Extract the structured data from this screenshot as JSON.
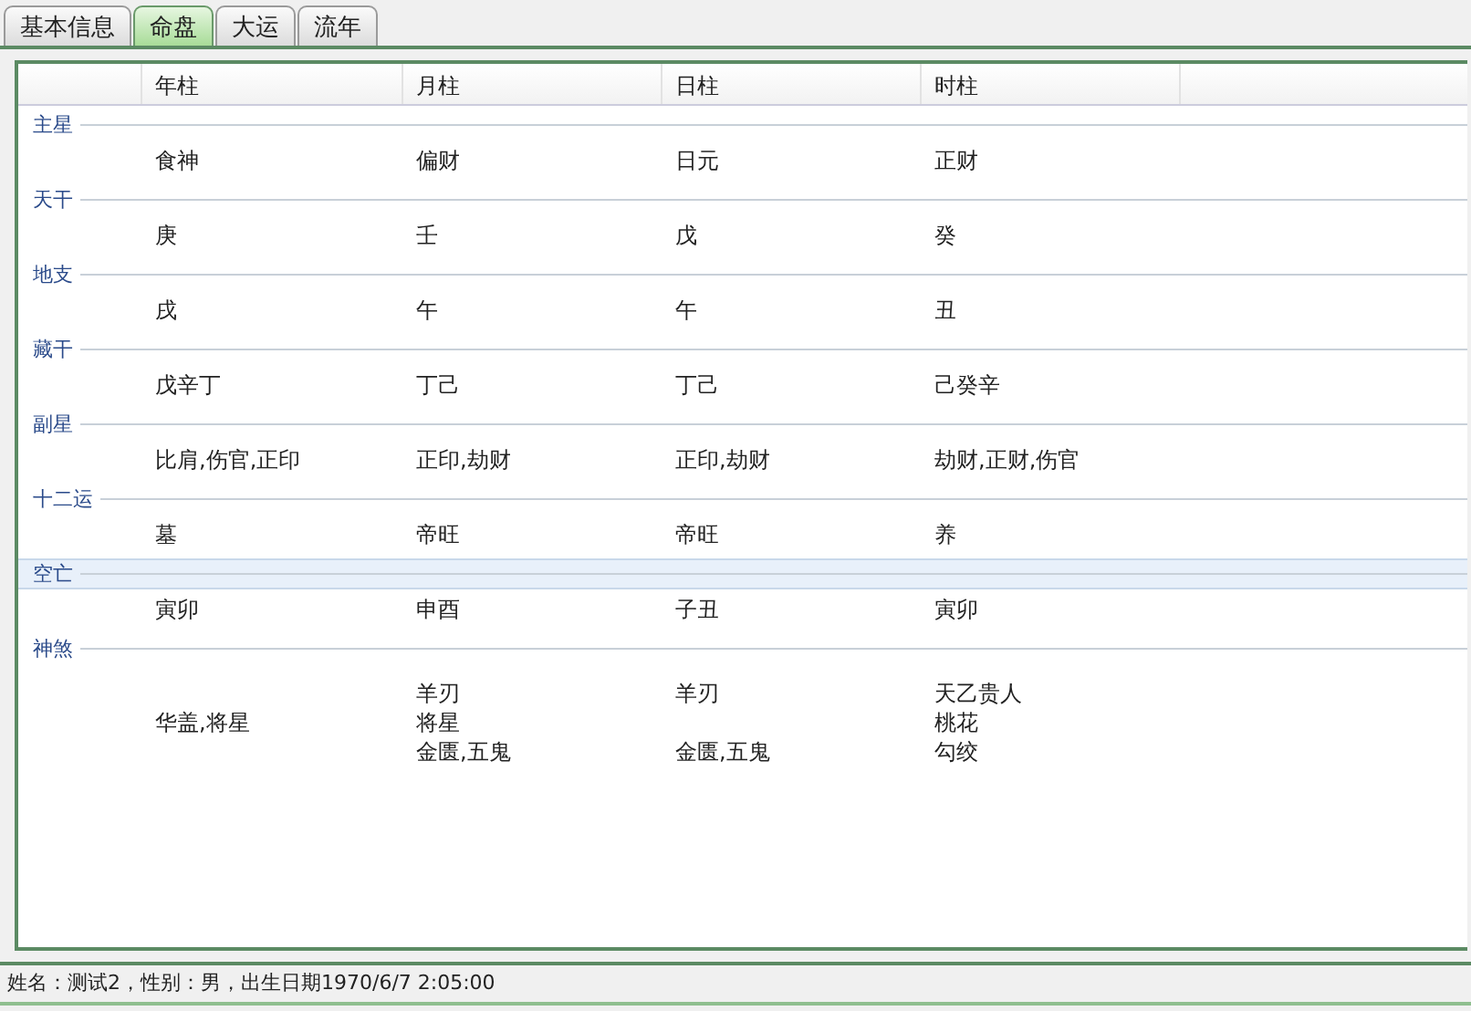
{
  "tabs": [
    {
      "label": "基本信息",
      "selected": false
    },
    {
      "label": "命盘",
      "selected": true
    },
    {
      "label": "大运",
      "selected": false
    },
    {
      "label": "流年",
      "selected": false
    }
  ],
  "table": {
    "columns": [
      "年柱",
      "月柱",
      "日柱",
      "时柱"
    ],
    "groups": [
      {
        "label": "主星",
        "selected": false,
        "cells": [
          "食神",
          "偏财",
          "日元",
          "正财"
        ]
      },
      {
        "label": "天干",
        "selected": false,
        "cells": [
          "庚",
          "壬",
          "戊",
          "癸"
        ]
      },
      {
        "label": "地支",
        "selected": false,
        "cells": [
          "戌",
          "午",
          "午",
          "丑"
        ]
      },
      {
        "label": "藏干",
        "selected": false,
        "cells": [
          "戊辛丁",
          "丁己",
          "丁己",
          "己癸辛"
        ]
      },
      {
        "label": "副星",
        "selected": false,
        "cells": [
          "比肩,伤官,正印",
          "正印,劫财",
          "正印,劫财",
          "劫财,正财,伤官"
        ]
      },
      {
        "label": "十二运",
        "selected": false,
        "cells": [
          "墓",
          "帝旺",
          "帝旺",
          "养"
        ]
      },
      {
        "label": "空亡",
        "selected": true,
        "cells": [
          "寅卯",
          "申酉",
          "子丑",
          "寅卯"
        ]
      },
      {
        "label": "神煞",
        "selected": false,
        "cells": [
          [
            "华盖,将星"
          ],
          [
            "羊刃",
            "将星",
            "金匮,五鬼"
          ],
          [
            "羊刃",
            null,
            "金匮,五鬼"
          ],
          [
            "天乙贵人",
            "桃花",
            "勾绞"
          ]
        ]
      }
    ]
  },
  "status_bar": "姓名：测试2，性别：男，出生日期1970/6/7 2:05:00"
}
